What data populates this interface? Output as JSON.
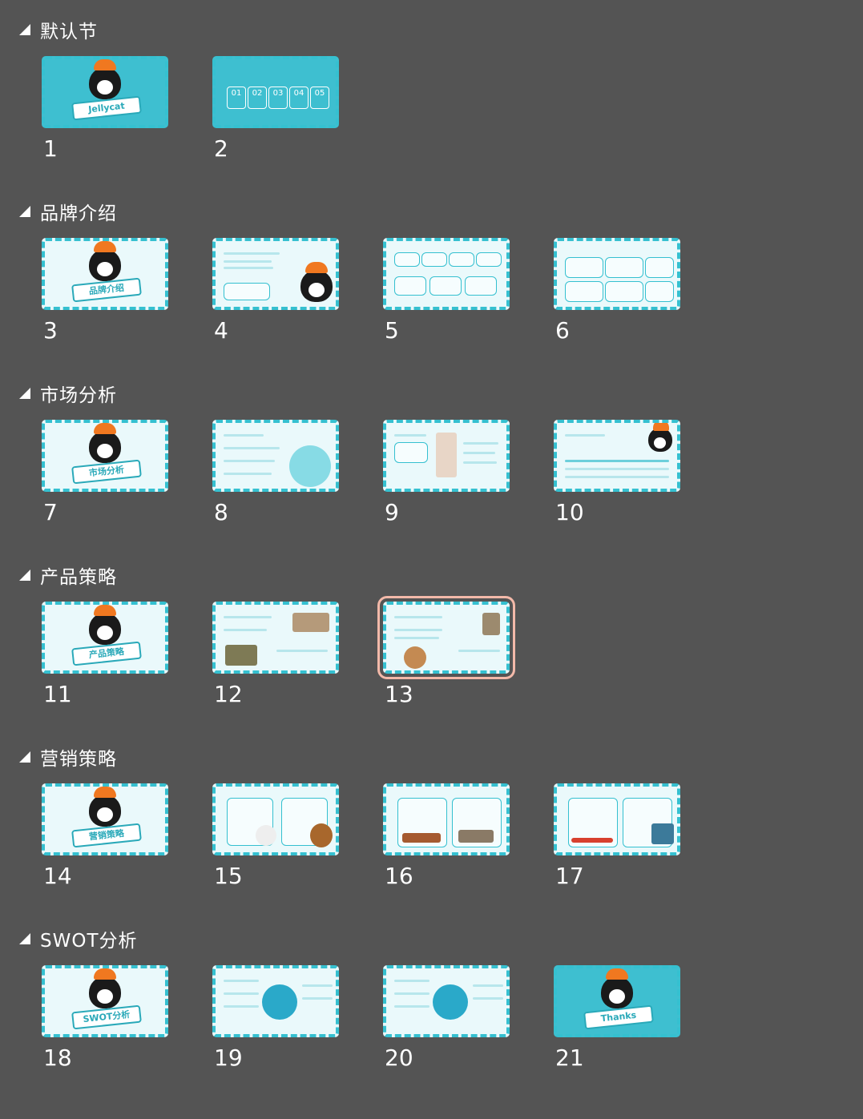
{
  "sections": [
    {
      "title": "默认节",
      "slides": [
        "1",
        "2"
      ]
    },
    {
      "title": "品牌介绍",
      "slides": [
        "3",
        "4",
        "5",
        "6"
      ]
    },
    {
      "title": "市场分析",
      "slides": [
        "7",
        "8",
        "9",
        "10"
      ]
    },
    {
      "title": "产品策略",
      "slides": [
        "11",
        "12",
        "13"
      ]
    },
    {
      "title": "营销策略",
      "slides": [
        "14",
        "15",
        "16",
        "17"
      ]
    },
    {
      "title": "SWOT分析",
      "slides": [
        "18",
        "19",
        "20",
        "21"
      ]
    }
  ],
  "thumb_text": {
    "s1": "Jellycat",
    "s2_toc": [
      "01",
      "02",
      "03",
      "04",
      "05"
    ],
    "s3": "品牌介绍",
    "s7": "市场分析",
    "s11": "产品策略",
    "s14": "营销策略",
    "s18": "SWOT分析",
    "s21": "Thanks"
  },
  "selected_slide": "13",
  "colors": {
    "background": "#545454",
    "slide_accent": "#35c0d0",
    "selection": "#f3b9a9"
  }
}
